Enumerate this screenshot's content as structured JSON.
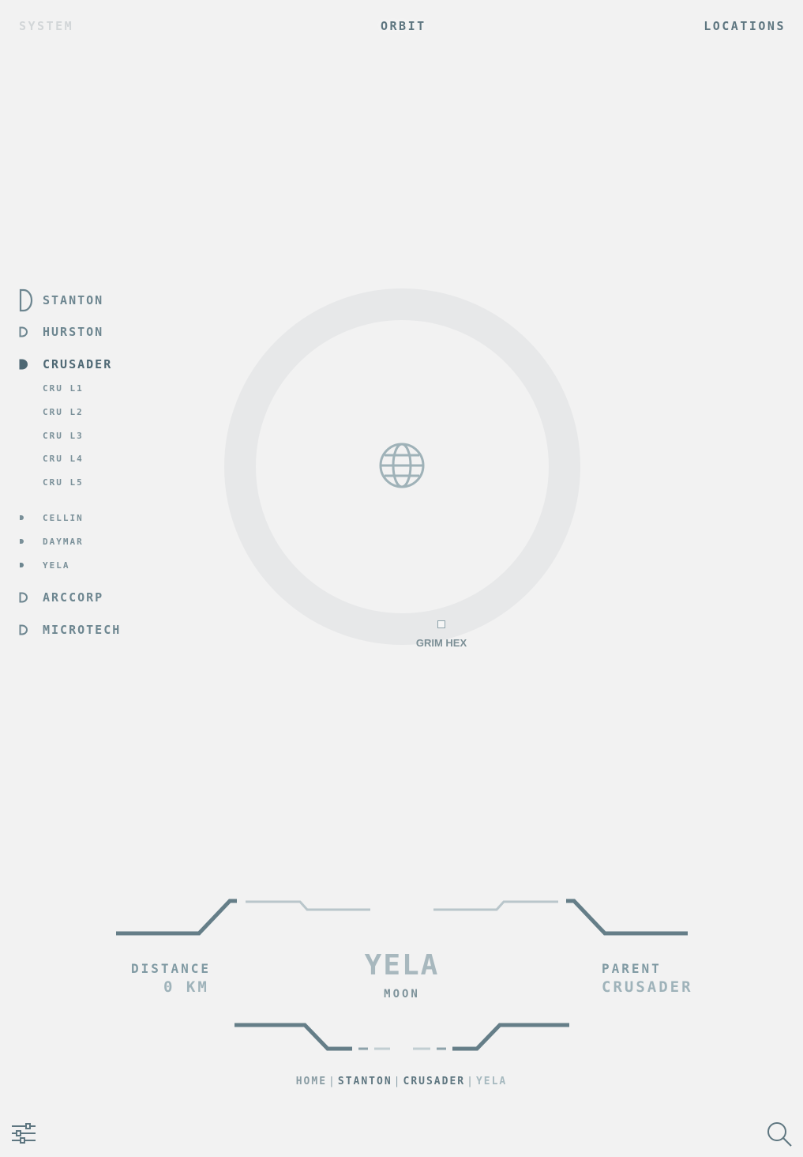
{
  "nav": {
    "system": "SYSTEM",
    "orbit": "ORBIT",
    "locations": "LOCATIONS"
  },
  "sidebar": {
    "items": [
      {
        "label": "STANTON"
      },
      {
        "label": "HURSTON"
      },
      {
        "label": "CRUSADER"
      },
      {
        "label": "CRU L1"
      },
      {
        "label": "CRU L2"
      },
      {
        "label": "CRU L3"
      },
      {
        "label": "CRU L4"
      },
      {
        "label": "CRU L5"
      },
      {
        "label": "CELLIN"
      },
      {
        "label": "DAYMAR"
      },
      {
        "label": "YELA"
      },
      {
        "label": "ARCCORP"
      },
      {
        "label": "MICROTECH"
      }
    ]
  },
  "orbit": {
    "poi_label": "GRIM HEX",
    "center_icon": "globe-icon"
  },
  "info": {
    "distance_title": "DISTANCE",
    "distance_value": "0 KM",
    "name": "YELA",
    "type": "MOON",
    "parent_title": "PARENT",
    "parent_value": "CRUSADER"
  },
  "breadcrumb": {
    "home": "HOME",
    "sep": "|",
    "stanton": "STANTON",
    "crusader": "CRUSADER",
    "current": "YELA"
  },
  "icons": {
    "settings": "sliders-icon",
    "search": "search-icon"
  },
  "colors": {
    "background": "#f2f2f2",
    "accent": "#5e7680",
    "ring": "#e7e8e9"
  }
}
